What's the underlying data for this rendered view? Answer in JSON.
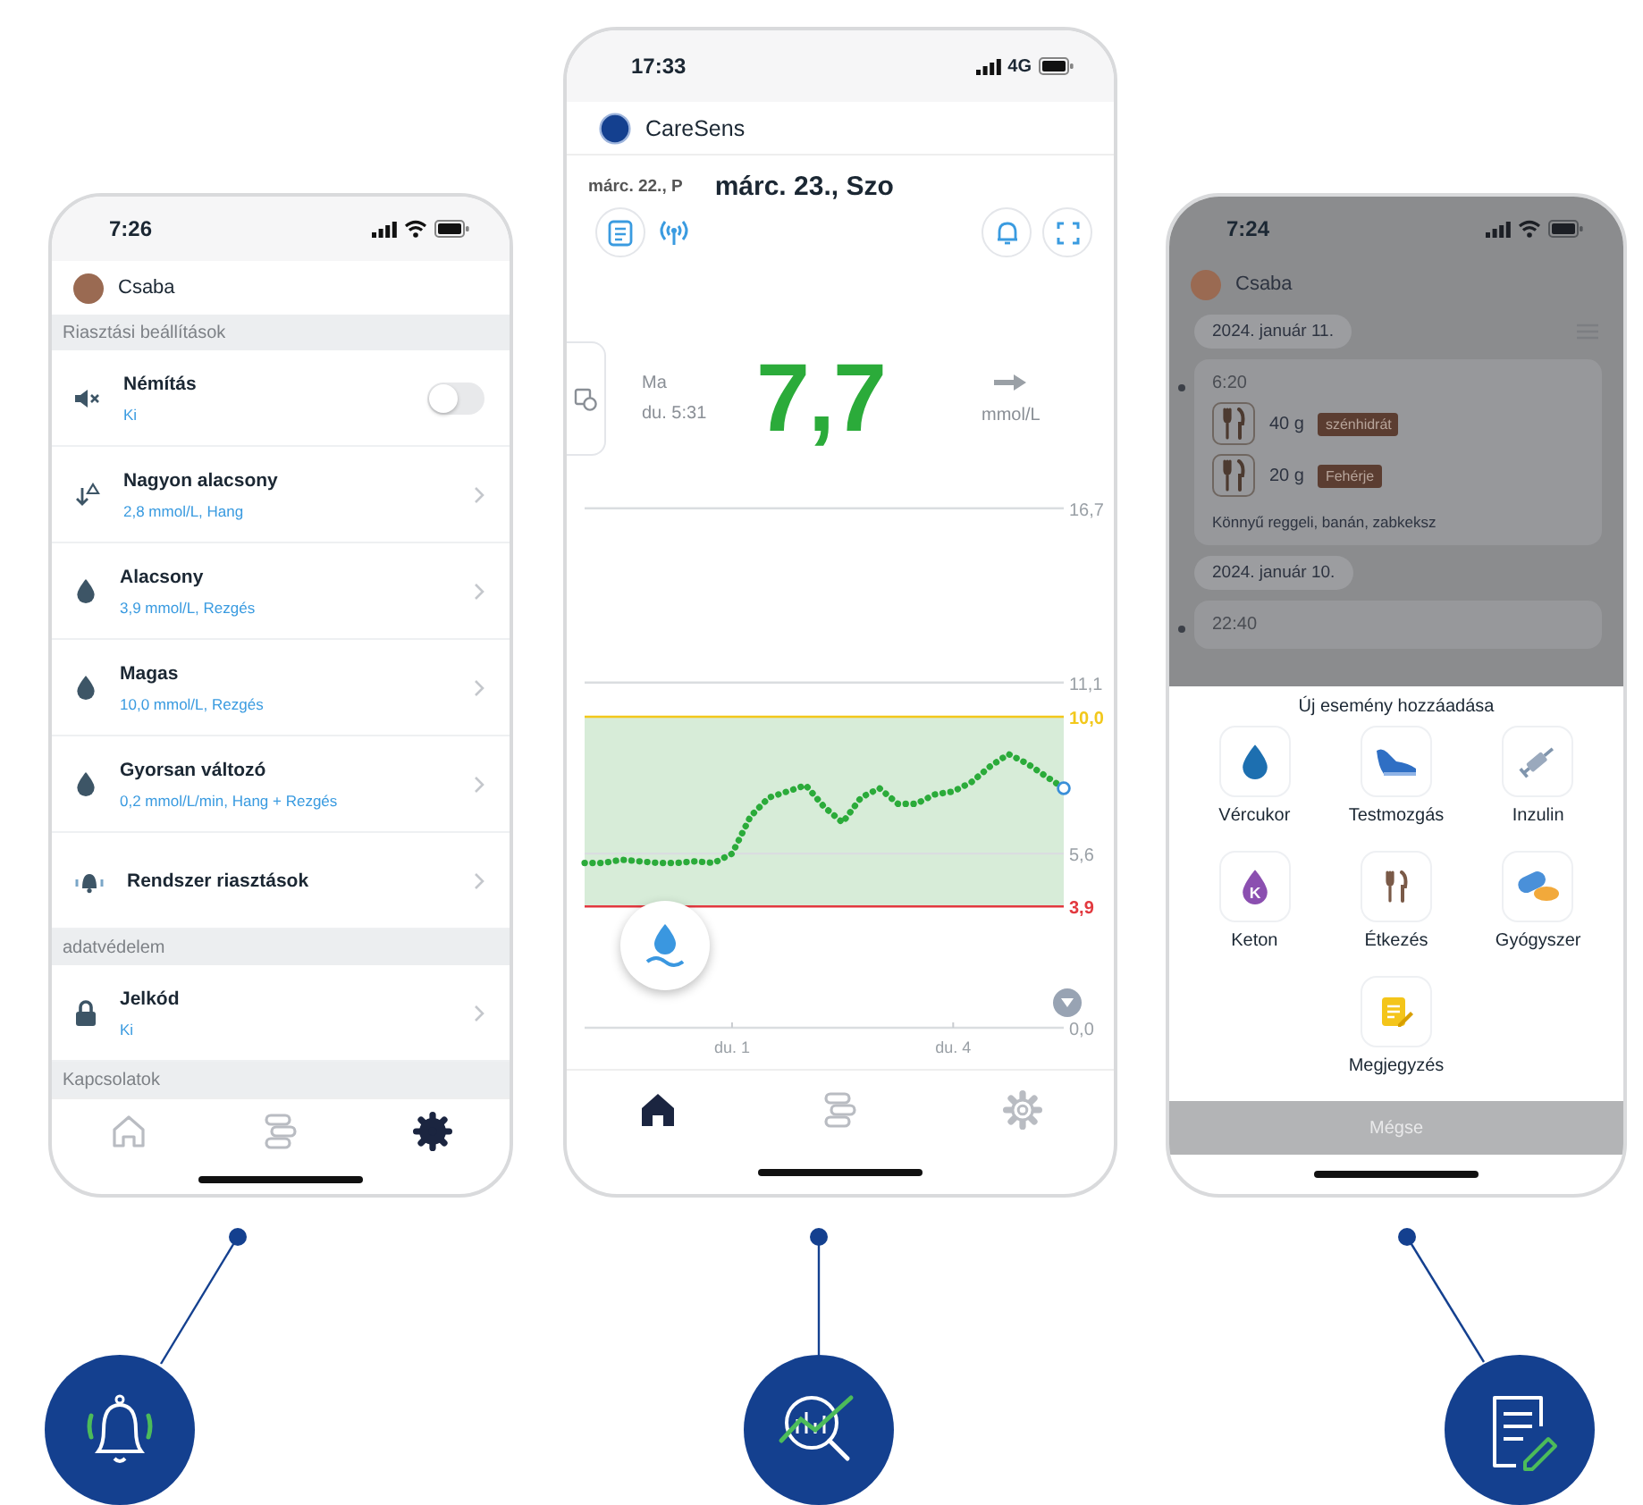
{
  "phones": [
    {
      "kind": "settings",
      "status_bar": {
        "time": "7:26"
      },
      "profile": {
        "name": "Csaba"
      },
      "sections": [
        {
          "title": "Riasztási beállítások",
          "items": [
            {
              "kind": "toggle",
              "title": "Némítás",
              "subtitle": "Ki",
              "on": false
            },
            {
              "kind": "link",
              "title": "Nagyon alacsony",
              "subtitle": "2,8 mmol/L, Hang"
            },
            {
              "kind": "link",
              "title": "Alacsony",
              "subtitle": "3,9 mmol/L, Rezgés"
            },
            {
              "kind": "link",
              "title": "Magas",
              "subtitle": "10,0 mmol/L, Rezgés"
            },
            {
              "kind": "link",
              "title": "Gyorsan változó",
              "subtitle": "0,2 mmol/L/min, Hang + Rezgés"
            },
            {
              "kind": "link",
              "title": "Rendszer riasztások"
            }
          ]
        },
        {
          "title": "adatvédelem",
          "items": [
            {
              "kind": "link",
              "title": "Jelkód",
              "subtitle": "Ki"
            }
          ]
        },
        {
          "title": "Kapcsolatok"
        }
      ],
      "tabs": [
        {
          "selected": false
        },
        {
          "selected": false
        },
        {
          "selected": true
        }
      ]
    },
    {
      "kind": "dashboard",
      "status_bar": {
        "time": "17:33",
        "network": "4G"
      },
      "device": {
        "name": "CareSens"
      },
      "dates": {
        "previous": "márc. 22., P",
        "current": "márc. 23., Szo"
      },
      "reading": {
        "day": "Ma",
        "time": "du. 5:31",
        "value": "7,7",
        "unit": "mmol/L"
      },
      "chart_data": {
        "type": "line",
        "ylim": [
          0,
          16.7
        ],
        "categories": [
          null,
          null,
          null,
          null,
          null,
          null,
          null,
          null,
          "du. 1",
          null,
          null,
          null,
          null,
          null,
          null,
          null,
          null,
          null,
          null,
          null,
          "du. 4",
          null,
          null,
          null,
          null,
          null,
          null
        ],
        "yticks": [
          {
            "value": 16.7,
            "label": "16,7"
          },
          {
            "value": 11.1,
            "label": "11,1"
          },
          {
            "value": 10,
            "label": "10,0"
          },
          {
            "value": 5.6,
            "label": "5,6"
          },
          {
            "value": 3.9,
            "label": "3,9"
          },
          {
            "value": 0,
            "label": "0,0"
          }
        ],
        "series": [
          {
            "color": "#2bab3a",
            "line_style": "dotted",
            "values": [
              5.3,
              5.3,
              5.4,
              5.35,
              5.3,
              5.3,
              5.35,
              5.3,
              5.6,
              6.8,
              7.4,
              7.6,
              7.8,
              7.1,
              6.6,
              7.4,
              7.7,
              7.2,
              7.2,
              7.5,
              7.6,
              7.9,
              8.4,
              8.8,
              8.5,
              8.1,
              7.7
            ]
          }
        ],
        "ref_lines": [
          {
            "axis": "y",
            "value": 10.0,
            "color": "#f2c81b"
          },
          {
            "axis": "y",
            "value": 3.9,
            "color": "#e2393f"
          }
        ],
        "bands": [
          {
            "axis": "y",
            "from": 3.9,
            "to": 10.0,
            "color": "#d7ecd8"
          }
        ]
      },
      "tabs": [
        {
          "selected": true
        },
        {
          "selected": false
        },
        {
          "selected": false
        }
      ]
    },
    {
      "kind": "log",
      "status_bar": {
        "time": "7:24"
      },
      "profile": {
        "name": "Csaba"
      },
      "timeline": [
        {
          "date": "2024. január 11.",
          "time": "6:20",
          "entries": [
            {
              "amount": "40 g",
              "tag": "szénhidrát"
            },
            {
              "amount": "20 g",
              "tag": "Fehérje"
            }
          ],
          "note": "Könnyű reggeli, banán, zabkeksz"
        },
        {
          "date": "2024. január 10.",
          "time": "22:40"
        }
      ],
      "sheet": {
        "title": "Új esemény hozzáadása",
        "options": [
          {
            "label": "Vércukor"
          },
          {
            "label": "Testmozgás"
          },
          {
            "label": "Inzulin"
          },
          {
            "label": "Keton",
            "badge": "K"
          },
          {
            "label": "Étkezés"
          },
          {
            "label": "Gyógyszer"
          },
          {
            "label": "Megjegyzés"
          }
        ],
        "cancel": "Mégse"
      }
    }
  ]
}
